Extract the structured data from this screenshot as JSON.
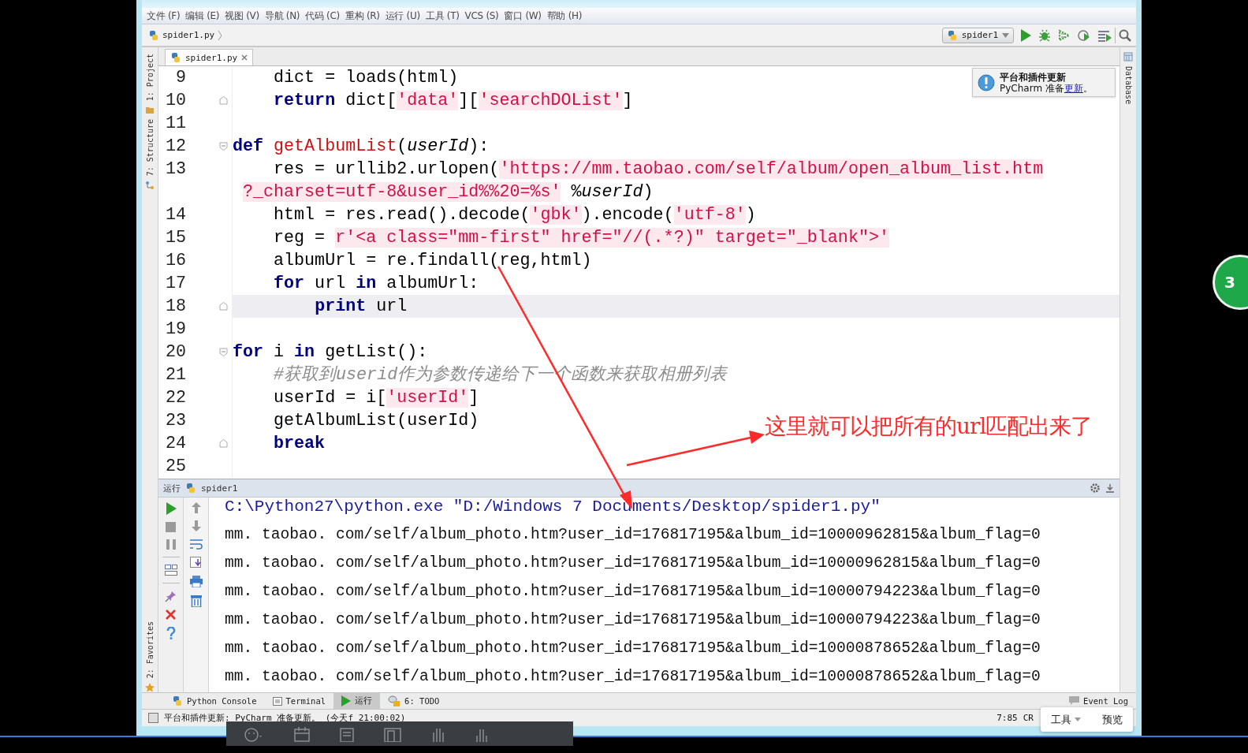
{
  "menu": [
    "文件 (F)",
    "编辑 (E)",
    "视图 (V)",
    "导航 (N)",
    "代码 (C)",
    "重构 (R)",
    "运行 (U)",
    "工具 (T)",
    "VCS (S)",
    "窗口 (W)",
    "帮助 (H)"
  ],
  "breadcrumb": {
    "file": "spider1.py"
  },
  "run_config": {
    "name": "spider1"
  },
  "side_tabs_left": [
    {
      "label": "1: Project"
    },
    {
      "label": "7: Structure"
    },
    {
      "label": "2: Favorites"
    }
  ],
  "side_tabs_right": [
    {
      "label": "Database"
    }
  ],
  "editor_tabs": [
    {
      "label": "spider1.py",
      "selected": true
    }
  ],
  "notification": {
    "title": "平台和插件更新",
    "text": "PyCharm 准备",
    "link": "更新",
    "tail": "。"
  },
  "code_lines": [
    {
      "kind": "line",
      "number": "9",
      "fold_start": false,
      "fold_end": false,
      "current": false,
      "tokens": [
        {
          "kind": "plain",
          "text": "    dict = loads(html)"
        }
      ]
    },
    {
      "kind": "line",
      "number": "10",
      "fold_start": false,
      "fold_end": true,
      "current": false,
      "tokens": [
        {
          "kind": "keyword",
          "text": "    return"
        },
        {
          "kind": "plain",
          "text": " dict["
        },
        {
          "kind": "string",
          "text": "'data'"
        },
        {
          "kind": "plain",
          "text": "]["
        },
        {
          "kind": "string",
          "text": "'searchDOList'"
        },
        {
          "kind": "plain",
          "text": "]"
        }
      ]
    },
    {
      "kind": "line",
      "number": "11",
      "fold_start": false,
      "fold_end": false,
      "current": false
    },
    {
      "kind": "line",
      "number": "12",
      "fold_start": true,
      "fold_end": false,
      "current": false,
      "tokens": [
        {
          "kind": "keyword",
          "text": "def"
        },
        {
          "kind": "function",
          "text": " getAlbumList"
        },
        {
          "kind": "plain",
          "text": "("
        },
        {
          "kind": "parameter",
          "text": "userId"
        },
        {
          "kind": "plain",
          "text": "):"
        }
      ]
    },
    {
      "kind": "line",
      "number": "13",
      "fold_start": false,
      "fold_end": false,
      "current": false,
      "tokens": [
        {
          "kind": "plain",
          "text": "    res = urllib2.urlopen("
        },
        {
          "kind": "string",
          "text": "'https://mm.taobao.com/self/album/open_album_list.htm"
        }
      ]
    },
    {
      "kind": "wrap",
      "fold_start": false,
      "fold_end": false,
      "current": false,
      "tokens": [
        {
          "kind": "string",
          "text": " ?_charset=utf-8&user_id%%20=%s'"
        },
        {
          "kind": "plain",
          "text": " %"
        },
        {
          "kind": "parameter",
          "text": "userId"
        },
        {
          "kind": "plain",
          "text": ")"
        }
      ]
    },
    {
      "kind": "line",
      "number": "14",
      "fold_start": false,
      "fold_end": false,
      "current": false,
      "tokens": [
        {
          "kind": "plain",
          "text": "    html = res.read().decode("
        },
        {
          "kind": "string",
          "text": "'gbk'"
        },
        {
          "kind": "plain",
          "text": ").encode("
        },
        {
          "kind": "string",
          "text": "'utf-8'"
        },
        {
          "kind": "plain",
          "text": ")"
        }
      ]
    },
    {
      "kind": "line",
      "number": "15",
      "fold_start": false,
      "fold_end": false,
      "current": false,
      "tokens": [
        {
          "kind": "plain",
          "text": "    reg = "
        },
        {
          "kind": "string",
          "text": "r'<a class=\"mm-first\" href=\"//(.*?)\" target=\"_blank\">'"
        }
      ]
    },
    {
      "kind": "line",
      "number": "16",
      "fold_start": false,
      "fold_end": false,
      "current": false,
      "tokens": [
        {
          "kind": "plain",
          "text": "    albumUrl = re.findall(reg,html)"
        }
      ]
    },
    {
      "kind": "line",
      "number": "17",
      "fold_start": false,
      "fold_end": false,
      "current": false,
      "tokens": [
        {
          "kind": "keyword",
          "text": "    for"
        },
        {
          "kind": "plain",
          "text": " url "
        },
        {
          "kind": "keyword",
          "text": "in"
        },
        {
          "kind": "plain",
          "text": " albumUrl:"
        }
      ]
    },
    {
      "kind": "line",
      "number": "18",
      "fold_start": false,
      "fold_end": true,
      "current": true,
      "tokens": [
        {
          "kind": "keyword",
          "text": "        print"
        },
        {
          "kind": "plain",
          "text": " url"
        }
      ]
    },
    {
      "kind": "line",
      "number": "19",
      "fold_start": false,
      "fold_end": false,
      "current": false
    },
    {
      "kind": "line",
      "number": "20",
      "fold_start": true,
      "fold_end": false,
      "current": false,
      "tokens": [
        {
          "kind": "keyword",
          "text": "for"
        },
        {
          "kind": "plain",
          "text": " i "
        },
        {
          "kind": "keyword",
          "text": "in"
        },
        {
          "kind": "plain",
          "text": " getList():"
        }
      ]
    },
    {
      "kind": "line",
      "number": "21",
      "fold_start": false,
      "fold_end": false,
      "current": false,
      "tokens": [
        {
          "kind": "comment",
          "text": "    #获取到userid作为参数传递给下一个函数来获取相册列表"
        }
      ]
    },
    {
      "kind": "line",
      "number": "22",
      "fold_start": false,
      "fold_end": false,
      "current": false,
      "tokens": [
        {
          "kind": "plain",
          "text": "    userId = i["
        },
        {
          "kind": "string",
          "text": "'userId'"
        },
        {
          "kind": "plain",
          "text": "]"
        }
      ]
    },
    {
      "kind": "line",
      "number": "23",
      "fold_start": false,
      "fold_end": false,
      "current": false,
      "tokens": [
        {
          "kind": "plain",
          "text": "    getAlbumList(userId)"
        }
      ]
    },
    {
      "kind": "line",
      "number": "24",
      "fold_start": false,
      "fold_end": true,
      "current": false,
      "tokens": [
        {
          "kind": "keyword",
          "text": "    break"
        }
      ]
    },
    {
      "kind": "line",
      "number": "25",
      "fold_start": false,
      "fold_end": false,
      "current": false
    }
  ],
  "run_panel": {
    "label": "运行",
    "config": "spider1",
    "output": [
      {
        "kind": "command",
        "text": "C:\\Python27\\python.exe \"D:/Windows 7 Documents/Desktop/spider1.py\""
      },
      {
        "kind": "output",
        "text": "mm. taobao. com/self/album_photo.htm?user_id=176817195&album_id=10000962815&album_flag=0"
      },
      {
        "kind": "output",
        "text": "mm. taobao. com/self/album_photo.htm?user_id=176817195&album_id=10000962815&album_flag=0"
      },
      {
        "kind": "output",
        "text": "mm. taobao. com/self/album_photo.htm?user_id=176817195&album_id=10000794223&album_flag=0"
      },
      {
        "kind": "output",
        "text": "mm. taobao. com/self/album_photo.htm?user_id=176817195&album_id=10000794223&album_flag=0"
      },
      {
        "kind": "output",
        "text": "mm. taobao. com/self/album_photo.htm?user_id=176817195&album_id=10000878652&album_flag=0"
      },
      {
        "kind": "output",
        "text": "mm. taobao. com/self/album_photo.htm?user_id=176817195&album_id=10000878652&album_flag=0"
      }
    ]
  },
  "tool_tabs": [
    {
      "kind": "console",
      "label": "Python Console",
      "selected": false
    },
    {
      "kind": "terminal",
      "label": "Terminal",
      "selected": false
    },
    {
      "kind": "run",
      "label": "运行",
      "selected": true
    },
    {
      "kind": "todo",
      "label": "6: TODO",
      "selected": false
    }
  ],
  "event_log": "Event Log",
  "status_bar": {
    "message": "平台和插件更新: PyCharm 准备更新。 (今天f 21:00:02)",
    "position": "7:85",
    "line_separator": "CR"
  },
  "popup": [
    {
      "label": "工具",
      "dropdown": true
    },
    {
      "label": "预览",
      "dropdown": false
    }
  ],
  "annotation": {
    "note": "这里就可以把所有的url匹配出来了"
  },
  "side_badge": {
    "text": "3"
  }
}
